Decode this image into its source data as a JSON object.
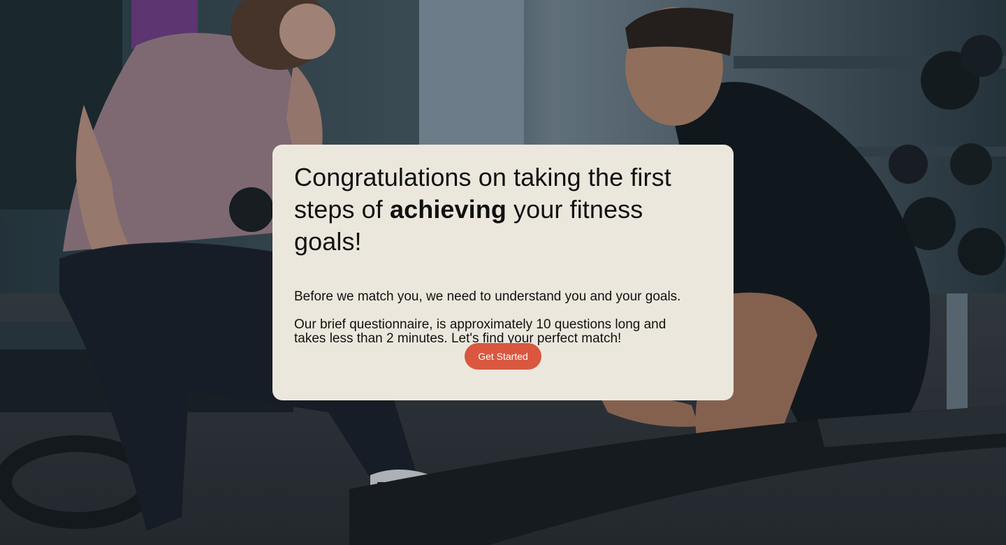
{
  "hero": {
    "headline_line1": "Congratulations on taking the first",
    "headline_line2_prefix": "steps of ",
    "headline_emphasis": "achieving",
    "headline_line2_suffix": " your fitness goals!",
    "paragraph_1": "Before we match you, we need to understand you and your goals.",
    "paragraph_2": "Our brief questionnaire, is approximately 10 questions long and takes less than 2 minutes. Let's find your perfect match!",
    "cta_label": "Get Started"
  },
  "background": {
    "image": "gym-training-session-photo"
  },
  "colors": {
    "card_background": "#ece7dd",
    "cta_background": "#d9573f",
    "cta_text": "#ffffff",
    "overlay_tint": "#12222a"
  }
}
